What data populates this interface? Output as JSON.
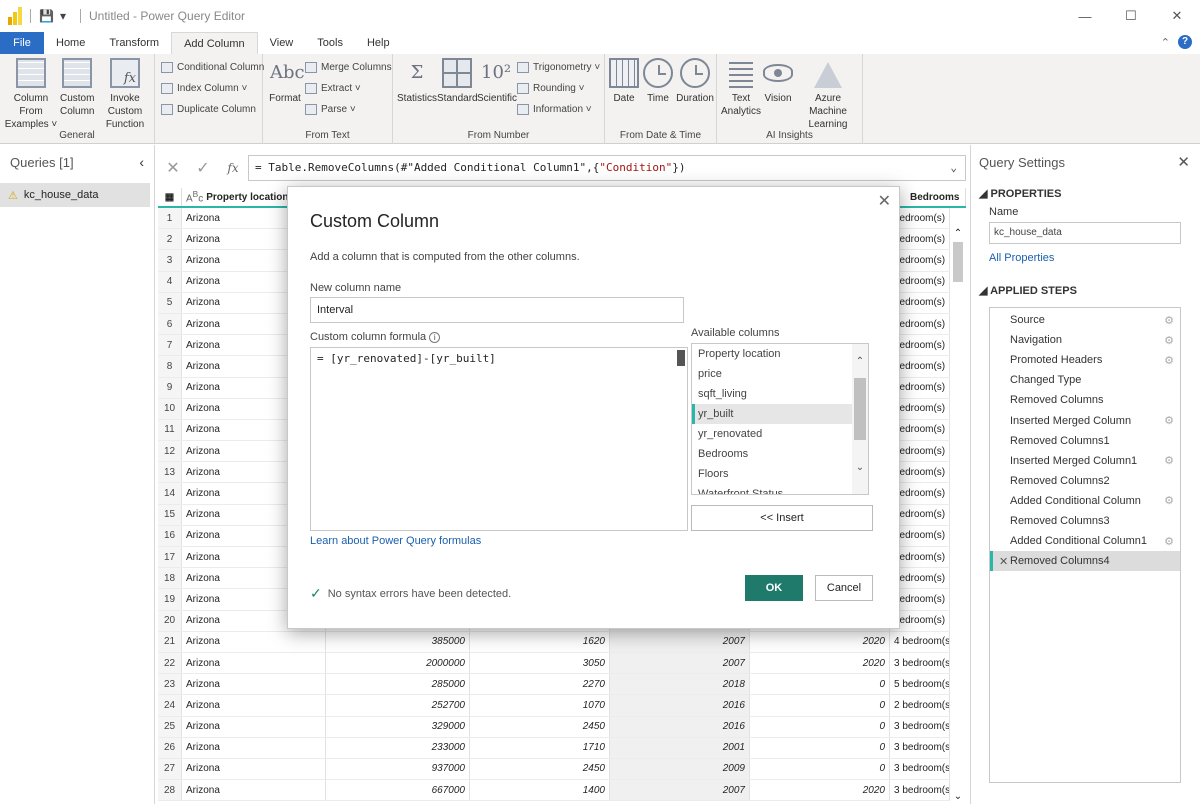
{
  "app": {
    "title": "Untitled - Power Query Editor",
    "window_controls": [
      "—",
      "☐",
      "✕"
    ]
  },
  "ribbon_tabs": [
    "File",
    "Home",
    "Transform",
    "Add Column",
    "View",
    "Tools",
    "Help"
  ],
  "ribbon": {
    "general": {
      "label": "General",
      "column_from_examples": "Column From Examples ˅",
      "custom_column": "Custom Column",
      "invoke_custom_function": "Invoke Custom Function",
      "conditional_column": "Conditional Column",
      "index_column": "Index Column ˅",
      "duplicate_column": "Duplicate Column"
    },
    "from_text": {
      "label": "From Text",
      "format": "Format",
      "merge_columns": "Merge Columns",
      "extract": "Extract ˅",
      "parse": "Parse ˅"
    },
    "from_number": {
      "label": "From Number",
      "statistics": "Statistics",
      "standard": "Standard",
      "scientific": "Scientific",
      "trigonometry": "Trigonometry ˅",
      "rounding": "Rounding ˅",
      "information": "Information ˅"
    },
    "from_date_time": {
      "label": "From Date & Time",
      "date": "Date",
      "time": "Time",
      "duration": "Duration"
    },
    "ai_insights": {
      "label": "AI Insights",
      "text_analytics": "Text Analytics",
      "vision": "Vision",
      "azure_ml": "Azure Machine Learning"
    }
  },
  "queries_pane": {
    "title": "Queries [1]",
    "items": [
      "kc_house_data"
    ]
  },
  "formula_bar": {
    "prefix": "= Table.RemoveColumns(#\"Added Conditional Column1\",{",
    "string": "\"Condition\"",
    "suffix": "})"
  },
  "grid": {
    "headers": [
      "Property location",
      "Bedrooms"
    ],
    "rows": [
      {
        "n": "1",
        "loc": "Arizona",
        "price": "",
        "living": "",
        "built": "",
        "renov": "",
        "bed": "bedroom(s)"
      },
      {
        "n": "2",
        "loc": "Arizona",
        "price": "",
        "living": "",
        "built": "",
        "renov": "",
        "bed": "bedroom(s)"
      },
      {
        "n": "3",
        "loc": "Arizona",
        "price": "",
        "living": "",
        "built": "",
        "renov": "",
        "bed": "bedroom(s)"
      },
      {
        "n": "4",
        "loc": "Arizona",
        "price": "",
        "living": "",
        "built": "",
        "renov": "",
        "bed": "bedroom(s)"
      },
      {
        "n": "5",
        "loc": "Arizona",
        "price": "",
        "living": "",
        "built": "",
        "renov": "",
        "bed": "bedroom(s)"
      },
      {
        "n": "6",
        "loc": "Arizona",
        "price": "",
        "living": "",
        "built": "",
        "renov": "",
        "bed": "bedroom(s)"
      },
      {
        "n": "7",
        "loc": "Arizona",
        "price": "",
        "living": "",
        "built": "",
        "renov": "",
        "bed": "bedroom(s)"
      },
      {
        "n": "8",
        "loc": "Arizona",
        "price": "",
        "living": "",
        "built": "",
        "renov": "",
        "bed": "bedroom(s)"
      },
      {
        "n": "9",
        "loc": "Arizona",
        "price": "",
        "living": "",
        "built": "",
        "renov": "",
        "bed": "bedroom(s)"
      },
      {
        "n": "10",
        "loc": "Arizona",
        "price": "",
        "living": "",
        "built": "",
        "renov": "",
        "bed": "bedroom(s)"
      },
      {
        "n": "11",
        "loc": "Arizona",
        "price": "",
        "living": "",
        "built": "",
        "renov": "",
        "bed": "bedroom(s)"
      },
      {
        "n": "12",
        "loc": "Arizona",
        "price": "",
        "living": "",
        "built": "",
        "renov": "",
        "bed": "bedroom(s)"
      },
      {
        "n": "13",
        "loc": "Arizona",
        "price": "",
        "living": "",
        "built": "",
        "renov": "",
        "bed": "bedroom(s)"
      },
      {
        "n": "14",
        "loc": "Arizona",
        "price": "",
        "living": "",
        "built": "",
        "renov": "",
        "bed": "bedroom(s)"
      },
      {
        "n": "15",
        "loc": "Arizona",
        "price": "",
        "living": "",
        "built": "",
        "renov": "",
        "bed": "bedroom(s)"
      },
      {
        "n": "16",
        "loc": "Arizona",
        "price": "",
        "living": "",
        "built": "",
        "renov": "",
        "bed": "bedroom(s)"
      },
      {
        "n": "17",
        "loc": "Arizona",
        "price": "",
        "living": "",
        "built": "",
        "renov": "",
        "bed": "bedroom(s)"
      },
      {
        "n": "18",
        "loc": "Arizona",
        "price": "",
        "living": "",
        "built": "",
        "renov": "",
        "bed": "bedroom(s)"
      },
      {
        "n": "19",
        "loc": "Arizona",
        "price": "",
        "living": "",
        "built": "",
        "renov": "",
        "bed": "bedroom(s)"
      },
      {
        "n": "20",
        "loc": "Arizona",
        "price": "",
        "living": "",
        "built": "",
        "renov": "",
        "bed": "bedroom(s)"
      },
      {
        "n": "21",
        "loc": "Arizona",
        "price": "385000",
        "living": "1620",
        "built": "2007",
        "renov": "2020",
        "bed": "4 bedroom(s)"
      },
      {
        "n": "22",
        "loc": "Arizona",
        "price": "2000000",
        "living": "3050",
        "built": "2007",
        "renov": "2020",
        "bed": "3 bedroom(s)"
      },
      {
        "n": "23",
        "loc": "Arizona",
        "price": "285000",
        "living": "2270",
        "built": "2018",
        "renov": "0",
        "bed": "5 bedroom(s)"
      },
      {
        "n": "24",
        "loc": "Arizona",
        "price": "252700",
        "living": "1070",
        "built": "2016",
        "renov": "0",
        "bed": "2 bedroom(s)"
      },
      {
        "n": "25",
        "loc": "Arizona",
        "price": "329000",
        "living": "2450",
        "built": "2016",
        "renov": "0",
        "bed": "3 bedroom(s)"
      },
      {
        "n": "26",
        "loc": "Arizona",
        "price": "233000",
        "living": "1710",
        "built": "2001",
        "renov": "0",
        "bed": "3 bedroom(s)"
      },
      {
        "n": "27",
        "loc": "Arizona",
        "price": "937000",
        "living": "2450",
        "built": "2009",
        "renov": "0",
        "bed": "3 bedroom(s)"
      },
      {
        "n": "28",
        "loc": "Arizona",
        "price": "667000",
        "living": "1400",
        "built": "2007",
        "renov": "2020",
        "bed": "3 bedroom(s)"
      }
    ]
  },
  "query_settings": {
    "title": "Query Settings",
    "properties_heading": "PROPERTIES",
    "name_label": "Name",
    "name_value": "kc_house_data",
    "all_properties": "All Properties",
    "applied_steps_heading": "APPLIED STEPS",
    "steps": [
      {
        "label": "Source",
        "gear": true
      },
      {
        "label": "Navigation",
        "gear": true
      },
      {
        "label": "Promoted Headers",
        "gear": true
      },
      {
        "label": "Changed Type",
        "gear": false
      },
      {
        "label": "Removed Columns",
        "gear": false
      },
      {
        "label": "Inserted Merged Column",
        "gear": true
      },
      {
        "label": "Removed Columns1",
        "gear": false
      },
      {
        "label": "Inserted Merged Column1",
        "gear": true
      },
      {
        "label": "Removed Columns2",
        "gear": false
      },
      {
        "label": "Added Conditional Column",
        "gear": true
      },
      {
        "label": "Removed Columns3",
        "gear": false
      },
      {
        "label": "Added Conditional Column1",
        "gear": true
      },
      {
        "label": "Removed Columns4",
        "gear": false,
        "selected": true
      }
    ]
  },
  "dialog": {
    "title": "Custom Column",
    "description": "Add a column that is computed from the other columns.",
    "name_label": "New column name",
    "name_value": "Interval",
    "formula_label": "Custom column formula",
    "formula_value": "= [yr_renovated]-[yr_built]",
    "available_label": "Available columns",
    "available_columns": [
      "Property location",
      "price",
      "sqft_living",
      "yr_built",
      "yr_renovated",
      "Bedrooms",
      "Floors",
      "Waterfront Status"
    ],
    "selected_column": "yr_built",
    "insert_label": "<< Insert",
    "learn_link": "Learn about Power Query formulas",
    "syntax_status": "No syntax errors have been detected.",
    "ok_label": "OK",
    "cancel_label": "Cancel"
  },
  "colors": {
    "file_tab": "#2b6cc4",
    "accent_teal": "#2ab7a9",
    "ok_button": "#1f7a6c",
    "link": "#1b5fad"
  }
}
